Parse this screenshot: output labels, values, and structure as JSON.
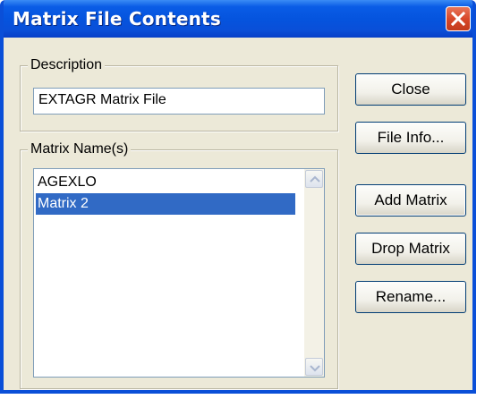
{
  "window": {
    "title": "Matrix File Contents"
  },
  "description": {
    "legend": "Description",
    "value": "EXTAGR Matrix File"
  },
  "matrices": {
    "legend": "Matrix Name(s)",
    "items": [
      {
        "label": "AGEXLO",
        "selected": false
      },
      {
        "label": "Matrix 2",
        "selected": true
      }
    ]
  },
  "buttons": {
    "close": "Close",
    "file_info": "File Info...",
    "add_matrix": "Add Matrix",
    "drop_matrix": "Drop Matrix",
    "rename": "Rename..."
  },
  "colors": {
    "titlebar": "#0a4fd8",
    "selection": "#316ac5",
    "close_button": "#d8482a"
  },
  "icons": {
    "close": "close-x-icon",
    "scroll_up": "chevron-up-icon",
    "scroll_down": "chevron-down-icon"
  }
}
